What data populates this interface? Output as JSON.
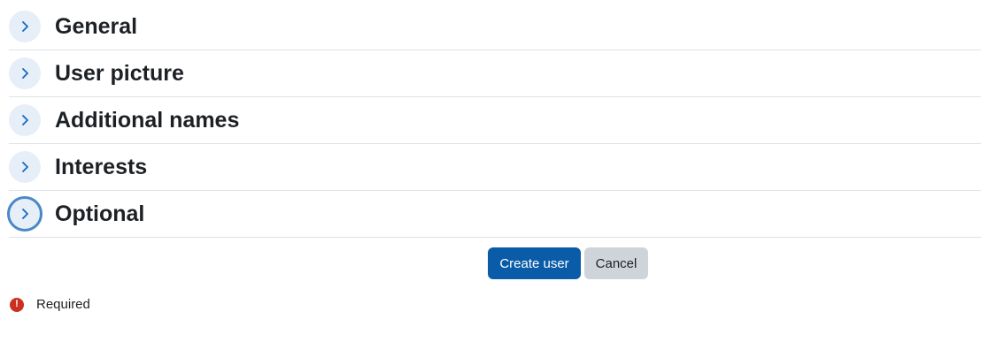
{
  "sections": [
    {
      "title": "General"
    },
    {
      "title": "User picture"
    },
    {
      "title": "Additional names"
    },
    {
      "title": "Interests"
    },
    {
      "title": "Optional"
    }
  ],
  "buttons": {
    "submit_label": "Create user",
    "cancel_label": "Cancel"
  },
  "required_note": {
    "icon_symbol": "!",
    "label": "Required"
  },
  "colors": {
    "primary": "#0a5ca8",
    "secondary": "#ced4da",
    "toggle_bg": "#e6eef8",
    "chevron": "#0f6cbf",
    "required": "#ca3120"
  },
  "icons": {
    "section_toggle": "chevron-right-icon",
    "required": "exclamation-circle-icon"
  }
}
